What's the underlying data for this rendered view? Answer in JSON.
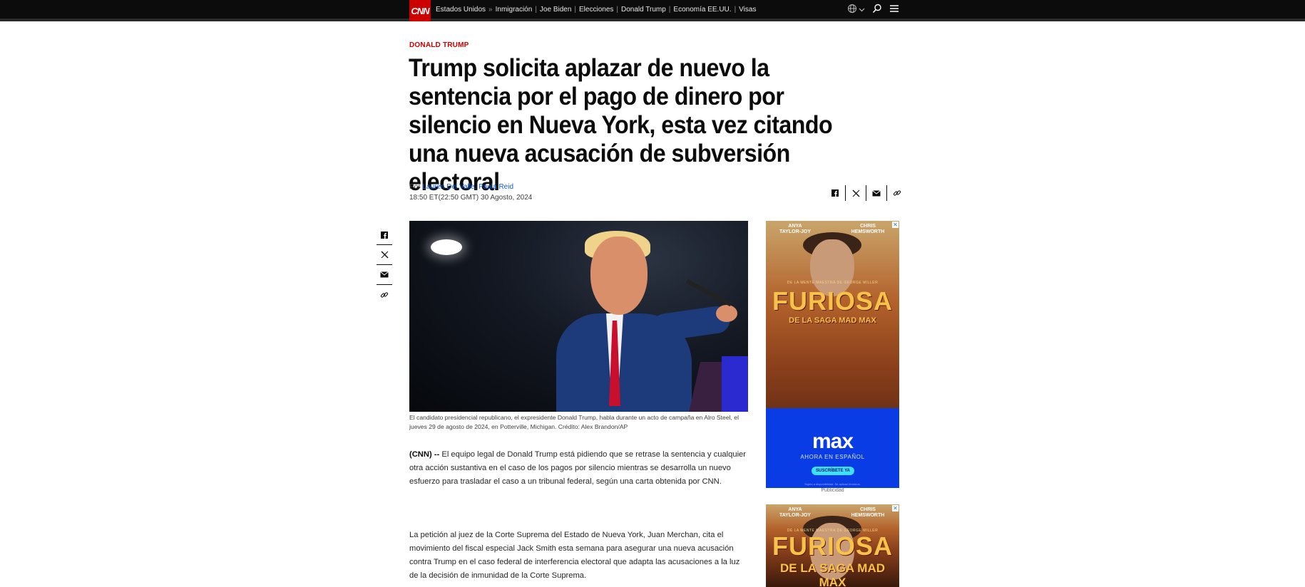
{
  "nav": {
    "logo": "CNN",
    "section": "Estados Unidos",
    "arrow": "»",
    "items": [
      "Inmigración",
      "Joe Biden",
      "Elecciones",
      "Donald Trump",
      "Economía EE.UU.",
      "Visas"
    ],
    "icons": [
      "globe-icon",
      "chevron-down-icon",
      "search-icon",
      "menu-icon"
    ]
  },
  "article": {
    "kicker": "DONALD TRUMP",
    "headline": "Trump solicita aplazar de nuevo la sentencia por el pago de dinero por silencio en Nueva York, esta vez citando una nueva acusación de subversión electoral",
    "byline_prefix": "Por",
    "authors": "Lauren Del Valle, Paula Reid",
    "timestamp": "18:50 ET(22:50 GMT) 30 Agosto, 2024",
    "share_icons": [
      "facebook-icon",
      "x-icon",
      "email-icon",
      "link-icon"
    ],
    "caption": "El candidato presidencial republicano, el expresidente Donald Trump, habla durante un acto de campaña en Alro Steel, el jueves 29 de agosto de 2024, en Potterville, Michigan. Crédito: Alex Brandon/AP",
    "p1_source": "(CNN) --",
    "p1": "El equipo legal de Donald Trump está pidiendo que se retrase la sentencia y cualquier otra acción sustantiva en el caso de los pagos por silencio mientras se desarrolla un nuevo esfuerzo para trasladar el caso a un tribunal federal, según una carta obtenida por CNN.",
    "p2": "La petición al juez de la Corte Suprema del Estado de Nueva York, Juan Merchan, cita el movimiento del fiscal especial Jack Smith esta semana para asegurar una nueva acusación contra Trump en el caso federal de interferencia electoral que adapta las acusaciones a la luz de la decisión de inmunidad de la Corte Suprema."
  },
  "ads": {
    "actor1": "ANYA TAYLOR-JOY",
    "actor2": "CHRIS HEMSWORTH",
    "tagline": "DE LA MENTE MAESTRA DE GEORGE MILLER",
    "title": "FURIOSA",
    "subtitle": "DE LA SAGA MAD MAX",
    "brand": "max",
    "brand_sub": "AHORA EN ESPAÑOL",
    "cta": "SUSCRÍBETE YA",
    "fine": "Sujeto a disponibilidad. Se aplican términos.",
    "label": "Publicidad",
    "close": "✕"
  }
}
